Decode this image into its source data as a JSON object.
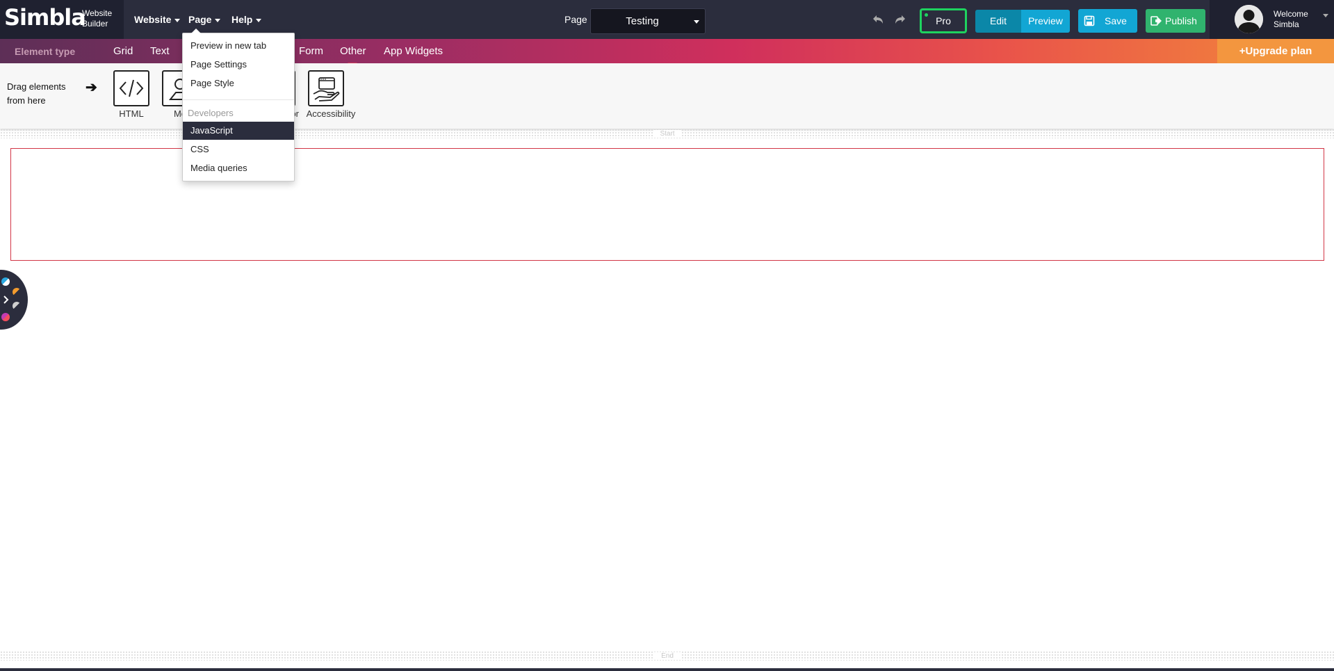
{
  "app": {
    "logo_text": "Simbla",
    "logo_sub_line1": "Website",
    "logo_sub_line2": "Builder"
  },
  "topbar": {
    "menu": [
      {
        "label": "Website"
      },
      {
        "label": "Page"
      },
      {
        "label": "Help"
      }
    ],
    "page_label": "Page",
    "page_select_value": "Testing",
    "pro_label": "Pro",
    "edit_label": "Edit",
    "preview_label": "Preview",
    "save_label": "Save",
    "publish_label": "Publish",
    "welcome_line1": "Welcome",
    "welcome_line2": "Simbla"
  },
  "element_types": {
    "label": "Element type",
    "items": [
      "Grid",
      "Text",
      "Form",
      "Other",
      "App Widgets"
    ],
    "upgrade_label": "+Upgrade plan"
  },
  "drag_area": {
    "label_line1": "Drag elements",
    "label_line2": "from here",
    "elements": [
      {
        "name": "HTML",
        "icon": "code-icon"
      },
      {
        "name": "Mo",
        "icon": "map-pin-icon"
      },
      {
        "name": "or",
        "icon": "unknown-icon"
      },
      {
        "name": "Accessibility",
        "icon": "accessibility-hand-icon"
      }
    ]
  },
  "canvas": {
    "start_label": "Start",
    "end_label": "End"
  },
  "page_dropdown": {
    "items": [
      "Preview in new tab",
      "Page Settings",
      "Page Style"
    ],
    "section_header": "Developers",
    "dev_items": [
      "JavaScript",
      "CSS",
      "Media queries"
    ],
    "active_item": "JavaScript"
  },
  "colors": {
    "topbar_bg": "#2b2d3d",
    "accent_blue": "#12a6d4",
    "publish_green": "#30b36e",
    "pro_border": "#1ed35f",
    "section_border": "#d23545"
  }
}
